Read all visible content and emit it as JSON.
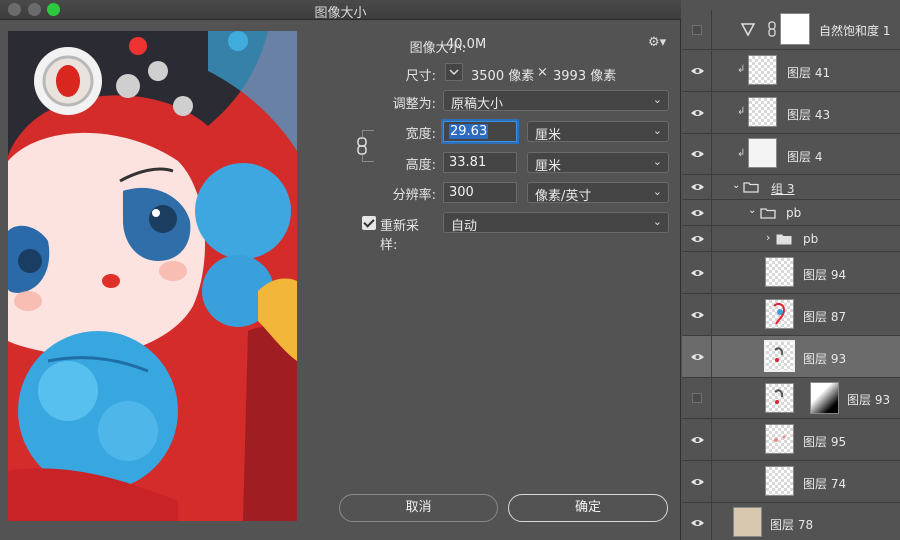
{
  "window": {
    "title": "图像大小"
  },
  "form": {
    "image_size_label": "图像大小:",
    "image_size_value": "40.0M",
    "dimensions_label": "尺寸:",
    "dimensions_width": "3500 像素",
    "dimensions_x": "×",
    "dimensions_height": "3993 像素",
    "fit_to_label": "调整为:",
    "fit_to_value": "原稿大小",
    "width_label": "宽度:",
    "width_value": "29.63",
    "width_unit": "厘米",
    "height_label": "高度:",
    "height_value": "33.81",
    "height_unit": "厘米",
    "resolution_label": "分辨率:",
    "resolution_value": "300",
    "resolution_unit": "像素/英寸",
    "resample_label": "重新采样:",
    "resample_value": "自动",
    "resample_checked": true
  },
  "buttons": {
    "cancel": "取消",
    "ok": "确定"
  },
  "layers": [
    {
      "name": "自然饱和度 1",
      "visible": false,
      "kind": "adjustment"
    },
    {
      "name": "图层 41",
      "visible": true,
      "kind": "clipped"
    },
    {
      "name": "图层 43",
      "visible": true,
      "kind": "clipped"
    },
    {
      "name": "图层 4",
      "visible": true,
      "kind": "clipped"
    },
    {
      "name": "组 3",
      "visible": true,
      "kind": "group"
    },
    {
      "name": "pb",
      "visible": true,
      "kind": "group"
    },
    {
      "name": "pb",
      "visible": true,
      "kind": "group-collapsed"
    },
    {
      "name": "图层 94",
      "visible": true,
      "kind": "layer"
    },
    {
      "name": "图层 87",
      "visible": true,
      "kind": "layer"
    },
    {
      "name": "图层 93",
      "visible": true,
      "kind": "layer",
      "selected": true
    },
    {
      "name": "图层 93",
      "visible": false,
      "kind": "masked"
    },
    {
      "name": "图层 95",
      "visible": true,
      "kind": "layer"
    },
    {
      "name": "图层 74",
      "visible": true,
      "kind": "layer"
    },
    {
      "name": "图层 78",
      "visible": true,
      "kind": "layer"
    }
  ],
  "colors": {
    "accent": "#3a8ee6",
    "panel": "#535353",
    "selected_row": "#6b6b6b",
    "traffic_green": "#2dc840"
  }
}
